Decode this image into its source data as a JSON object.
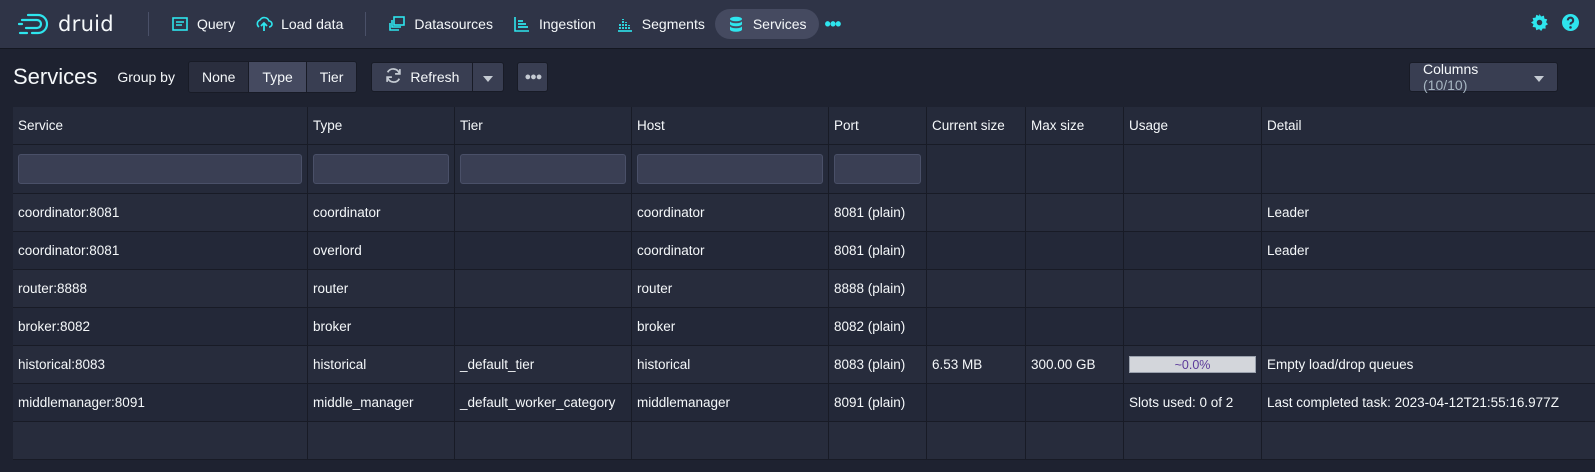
{
  "app": {
    "logo_text": "druid",
    "accent_color": "#2ee5ee"
  },
  "nav": {
    "items": [
      {
        "label": "Query",
        "icon": "query-icon"
      },
      {
        "label": "Load data",
        "icon": "cloud-upload-icon"
      },
      {
        "label": "Datasources",
        "icon": "datasources-icon"
      },
      {
        "label": "Ingestion",
        "icon": "ingestion-icon"
      },
      {
        "label": "Segments",
        "icon": "segments-icon"
      },
      {
        "label": "Services",
        "icon": "database-icon",
        "active": true
      }
    ],
    "more_icon": "more-horizontal-icon",
    "right_icons": [
      "gear-icon",
      "help-icon"
    ]
  },
  "toolbar": {
    "title": "Services",
    "group_by_label": "Group by",
    "group_by_options": [
      "None",
      "Type",
      "Tier"
    ],
    "group_by_selected": "Type",
    "refresh_label": "Refresh",
    "columns_label": "Columns",
    "columns_count": "(10/10)"
  },
  "table": {
    "headers": [
      "Service",
      "Type",
      "Tier",
      "Host",
      "Port",
      "Current size",
      "Max size",
      "Usage",
      "Detail"
    ],
    "rows": [
      {
        "service": "coordinator:8081",
        "type": "coordinator",
        "tier": "",
        "host": "coordinator",
        "port": "8081 (plain)",
        "current_size": "",
        "max_size": "",
        "usage": "",
        "detail": "Leader"
      },
      {
        "service": "coordinator:8081",
        "type": "overlord",
        "tier": "",
        "host": "coordinator",
        "port": "8081 (plain)",
        "current_size": "",
        "max_size": "",
        "usage": "",
        "detail": "Leader"
      },
      {
        "service": "router:8888",
        "type": "router",
        "tier": "",
        "host": "router",
        "port": "8888 (plain)",
        "current_size": "",
        "max_size": "",
        "usage": "",
        "detail": ""
      },
      {
        "service": "broker:8082",
        "type": "broker",
        "tier": "",
        "host": "broker",
        "port": "8082 (plain)",
        "current_size": "",
        "max_size": "",
        "usage": "",
        "detail": ""
      },
      {
        "service": "historical:8083",
        "type": "historical",
        "tier": "_default_tier",
        "host": "historical",
        "port": "8083 (plain)",
        "current_size": "6.53 MB",
        "max_size": "300.00 GB",
        "usage": "~0.0%",
        "detail": "Empty load/drop queues"
      },
      {
        "service": "middlemanager:8091",
        "type": "middle_manager",
        "tier": "_default_worker_category",
        "host": "middlemanager",
        "port": "8091 (plain)",
        "current_size": "",
        "max_size": "",
        "usage": "Slots used: 0 of 2",
        "detail": "Last completed task: 2023-04-12T21:55:16.977Z"
      }
    ]
  }
}
